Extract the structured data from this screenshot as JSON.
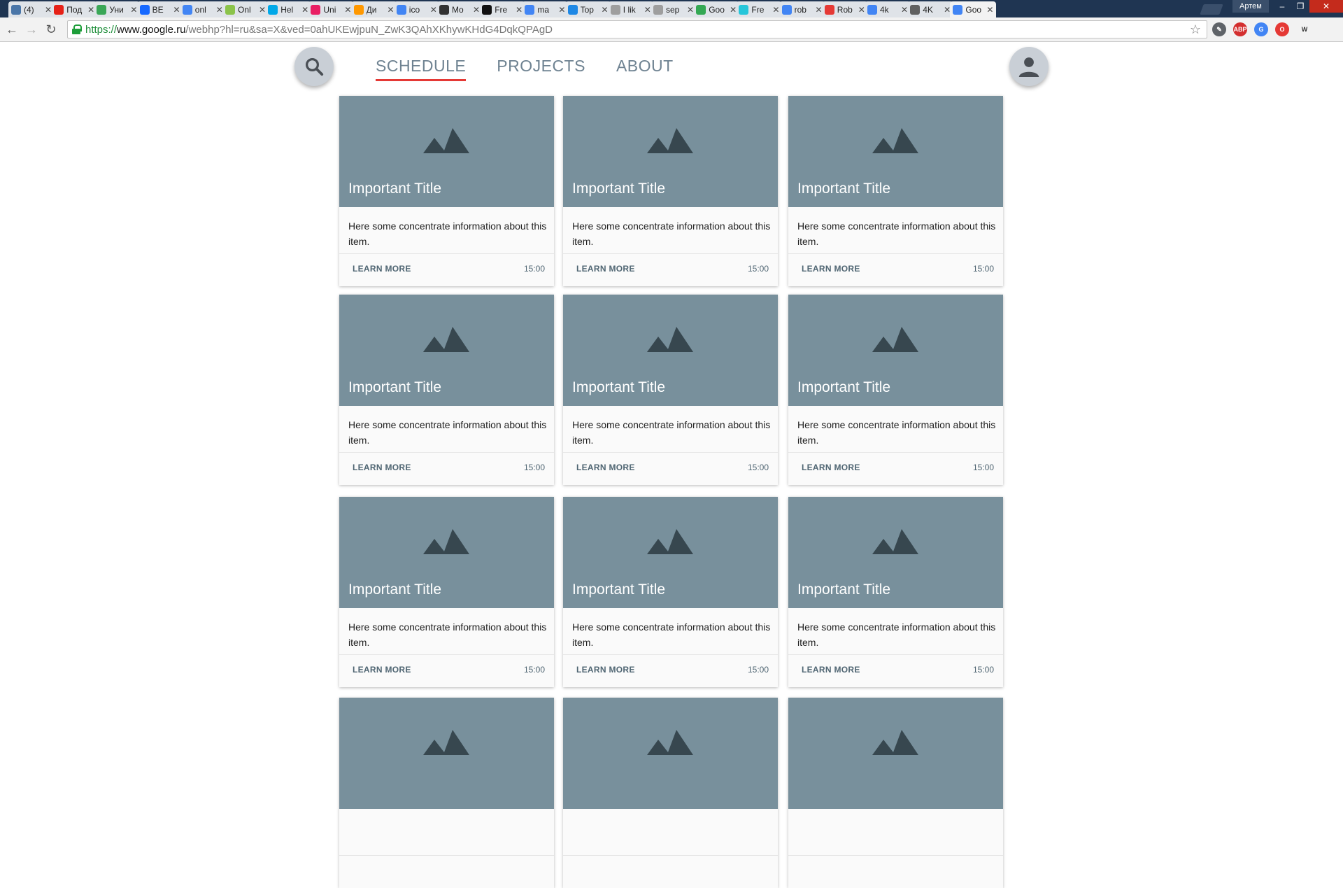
{
  "browser": {
    "tabs": [
      {
        "label": "(4)",
        "favicon_color": "#4a76a8"
      },
      {
        "label": "Под",
        "favicon_color": "#e62117"
      },
      {
        "label": "Уни",
        "favicon_color": "#3aa757"
      },
      {
        "label": "BE",
        "favicon_color": "#1769ff"
      },
      {
        "label": "onl",
        "favicon_color": "#4285f4"
      },
      {
        "label": "Onl",
        "favicon_color": "#8bc34a"
      },
      {
        "label": "Hel",
        "favicon_color": "#00a8e8"
      },
      {
        "label": "Uni",
        "favicon_color": "#e91e63"
      },
      {
        "label": "Ди",
        "favicon_color": "#ff9800"
      },
      {
        "label": "ico",
        "favicon_color": "#4285f4"
      },
      {
        "label": "Mo",
        "favicon_color": "#333333"
      },
      {
        "label": "Fre",
        "favicon_color": "#111111"
      },
      {
        "label": "ma",
        "favicon_color": "#4285f4"
      },
      {
        "label": "Top",
        "favicon_color": "#1e88e5"
      },
      {
        "label": "I lik",
        "favicon_color": "#9e9e9e"
      },
      {
        "label": "sep",
        "favicon_color": "#9e9e9e"
      },
      {
        "label": "Goo",
        "favicon_color": "#34a853"
      },
      {
        "label": "Fre",
        "favicon_color": "#26c6da"
      },
      {
        "label": "rob",
        "favicon_color": "#4285f4"
      },
      {
        "label": "Rob",
        "favicon_color": "#e53935"
      },
      {
        "label": "4k",
        "favicon_color": "#4285f4"
      },
      {
        "label": "4K",
        "favicon_color": "#616161"
      },
      {
        "label": "Goo",
        "favicon_color": "#4285f4",
        "active": true
      }
    ],
    "tab_close_glyph": "✕",
    "user_name": "Артем",
    "window_controls": [
      "–",
      "❐",
      "✕"
    ],
    "url": {
      "scheme": "https://",
      "host": "www.google.ru",
      "path": "/webhp?hl=ru&sa=X&ved=0ahUKEwjpuN_ZwK3QAhXKhywKHdG4DqkQPAgD"
    },
    "extensions": [
      {
        "name": "eyedropper",
        "label": "✎",
        "color": "#5f6368"
      },
      {
        "name": "adblock-plus",
        "label": "ABP",
        "color": "#d32f2f"
      },
      {
        "name": "google-translate",
        "label": "G",
        "color": "#4285f4"
      },
      {
        "name": "opera",
        "label": "O",
        "color": "#e53935"
      },
      {
        "name": "wikipedia",
        "label": "W",
        "color": "#ffffff"
      }
    ]
  },
  "nav": {
    "tabs": [
      {
        "label": "SCHEDULE",
        "active": true
      },
      {
        "label": "PROJECTS",
        "active": false
      },
      {
        "label": "ABOUT",
        "active": false
      }
    ]
  },
  "cards": [
    {
      "title": "Important Title",
      "text": "Here some concentrate information about this item.",
      "action": "LEARN MORE",
      "time": "15:00"
    },
    {
      "title": "Important Title",
      "text": "Here some concentrate information about this item.",
      "action": "LEARN MORE",
      "time": "15:00"
    },
    {
      "title": "Important Title",
      "text": "Here some concentrate information about this item.",
      "action": "LEARN MORE",
      "time": "15:00"
    },
    {
      "title": "Important Title",
      "text": "Here some concentrate information about this item.",
      "action": "LEARN MORE",
      "time": "15:00"
    },
    {
      "title": "Important Title",
      "text": "Here some concentrate information about this item.",
      "action": "LEARN MORE",
      "time": "15:00"
    },
    {
      "title": "Important Title",
      "text": "Here some concentrate information about this item.",
      "action": "LEARN MORE",
      "time": "15:00"
    },
    {
      "title": "Important Title",
      "text": "Here some concentrate information about this item.",
      "action": "LEARN MORE",
      "time": "15:00"
    },
    {
      "title": "Important Title",
      "text": "Here some concentrate information about this item.",
      "action": "LEARN MORE",
      "time": "15:00"
    },
    {
      "title": "Important Title",
      "text": "Here some concentrate information about this item.",
      "action": "LEARN MORE",
      "time": "15:00"
    },
    {
      "title": "",
      "text": "",
      "action": "",
      "time": ""
    },
    {
      "title": "",
      "text": "",
      "action": "",
      "time": ""
    },
    {
      "title": "",
      "text": "",
      "action": "",
      "time": ""
    }
  ],
  "colors": {
    "card_media": "#78909c",
    "mountain_icon": "#37474f",
    "nav_active_underline": "#e53935",
    "nav_text": "#6e8291"
  },
  "icons": {
    "card_media": "mountain-image-icon",
    "search": "search-icon",
    "avatar": "person-icon"
  }
}
